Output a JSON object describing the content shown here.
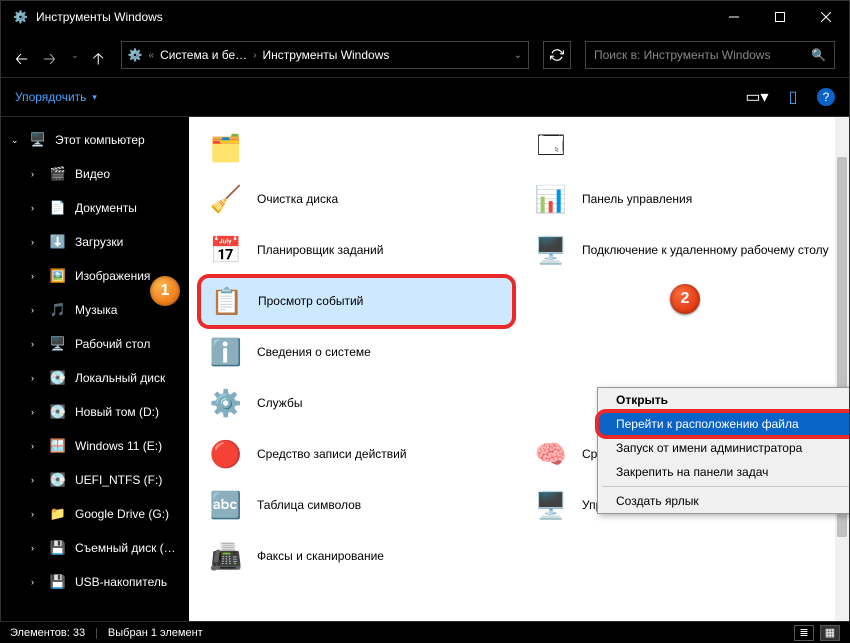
{
  "window_title": "Инструменты Windows",
  "nav": {
    "back_enabled": true,
    "forward_enabled": false
  },
  "breadcrumb": {
    "seg1": "Система и бе…",
    "seg2": "Инструменты Windows"
  },
  "refresh_icon": "refresh",
  "search": {
    "placeholder": "Поиск в: Инструменты Windows"
  },
  "toolbar": {
    "organize": "Упорядочить"
  },
  "sidebar": {
    "root": "Этот компьютер",
    "items": [
      {
        "label": "Видео"
      },
      {
        "label": "Документы"
      },
      {
        "label": "Загрузки"
      },
      {
        "label": "Изображения"
      },
      {
        "label": "Музыка"
      },
      {
        "label": "Рабочий стол"
      },
      {
        "label": "Локальный диск"
      },
      {
        "label": "Новый том (D:)"
      },
      {
        "label": "Windows 11 (E:)"
      },
      {
        "label": "UEFI_NTFS (F:)"
      },
      {
        "label": "Google Drive (G:)"
      },
      {
        "label": "Съемный диск (…"
      },
      {
        "label": "USB-накопитель"
      }
    ]
  },
  "content": {
    "left": [
      {
        "label": ""
      },
      {
        "label": "Очистка диска"
      },
      {
        "label": "Планировщик заданий"
      },
      {
        "label": "Просмотр событий",
        "selected": true,
        "callout": 1
      },
      {
        "label": "Сведения о системе"
      },
      {
        "label": "Службы"
      },
      {
        "label": "Средство записи действий"
      },
      {
        "label": "Таблица символов"
      },
      {
        "label": "Факсы и сканирование"
      }
    ],
    "right": [
      {
        "label": ""
      },
      {
        "label": "Панель управления"
      },
      {
        "label": "Подключение к удаленному рабочему столу"
      },
      {
        "label": ""
      },
      {
        "label": ""
      },
      {
        "label": ""
      },
      {
        "label": "Средство проверки памяти Windows"
      },
      {
        "label": "Управление компьютером"
      },
      {
        "label": ""
      }
    ]
  },
  "context_menu": {
    "items": [
      {
        "label": "Открыть",
        "bold": true
      },
      {
        "label": "Перейти к расположению файла",
        "selected": true,
        "callout": 2
      },
      {
        "label": "Запуск от имени администратора"
      },
      {
        "label": "Закрепить на панели задач"
      },
      {
        "sep": true
      },
      {
        "label": "Создать ярлык"
      }
    ]
  },
  "status": {
    "elements_label": "Элементов: 33",
    "selected_label": "Выбран 1 элемент"
  },
  "callouts": {
    "1": "1",
    "2": "2"
  }
}
